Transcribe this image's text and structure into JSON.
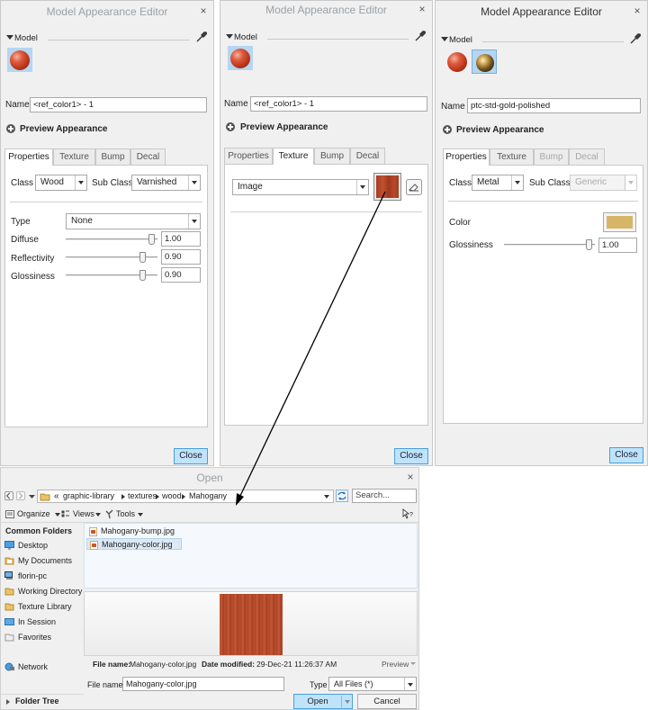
{
  "panel1": {
    "title": "Model Appearance Editor",
    "close_glyph": "×",
    "model_label": "Model",
    "name_label": "Name",
    "name_value": "<ref_color1> - 1",
    "preview_label": "Preview Appearance",
    "tabs": [
      "Properties",
      "Texture",
      "Bump",
      "Decal"
    ],
    "class_label": "Class",
    "class_value": "Wood",
    "subclass_label": "Sub Class",
    "subclass_value": "Varnished",
    "type_label": "Type",
    "type_value": "None",
    "diffuse_label": "Diffuse",
    "diffuse_value": "1.00",
    "reflectivity_label": "Reflectivity",
    "reflectivity_value": "0.90",
    "glossiness_label": "Glossiness",
    "glossiness_value": "0.90",
    "close_button": "Close"
  },
  "panel2": {
    "title": "Model Appearance Editor",
    "close_glyph": "×",
    "model_label": "Model",
    "name_label": "Name",
    "name_value": "<ref_color1> - 1",
    "preview_label": "Preview Appearance",
    "tabs": [
      "Properties",
      "Texture",
      "Bump",
      "Decal"
    ],
    "texture_type_value": "Image",
    "close_button": "Close"
  },
  "panel3": {
    "title": "Model Appearance Editor",
    "close_glyph": "×",
    "model_label": "Model",
    "name_label": "Name",
    "name_value": "ptc-std-gold-polished",
    "preview_label": "Preview Appearance",
    "tabs": [
      "Properties",
      "Texture",
      "Bump",
      "Decal"
    ],
    "class_label": "Class",
    "class_value": "Metal",
    "subclass_label": "Sub Class",
    "subclass_value": "Generic",
    "color_label": "Color",
    "glossiness_label": "Glossiness",
    "glossiness_value": "1.00",
    "close_button": "Close"
  },
  "open_dialog": {
    "title": "Open",
    "close_glyph": "×",
    "breadcrumb_prefix": "«",
    "breadcrumb": [
      "graphic-library",
      "textures",
      "wood",
      "Mahogany"
    ],
    "search_placeholder": "Search...",
    "toolbar": {
      "organize": "Organize",
      "views": "Views",
      "tools": "Tools"
    },
    "common_folders_label": "Common Folders",
    "sidebar": [
      "Desktop",
      "My Documents",
      "florin-pc",
      "Working Directory",
      "Texture Library",
      "In Session",
      "Favorites"
    ],
    "network_label": "Network",
    "folder_tree_label": "Folder Tree",
    "files": [
      "Mahogany-bump.jpg",
      "Mahogany-color.jpg"
    ],
    "info_filename_label": "File name:",
    "info_filename_value": "Mahogany-color.jpg",
    "info_modified_label": "Date modified:",
    "info_modified_value": "29-Dec-21 11:26:37 AM",
    "preview_label": "Preview",
    "filename_label": "File name",
    "filename_value": "Mahogany-color.jpg",
    "type_label": "Type",
    "type_value": "All Files (*)",
    "open_button": "Open",
    "cancel_button": "Cancel"
  },
  "colors": {
    "accent_button": "#bfe3fb",
    "gold_swatch": "#d6b567",
    "mahogany": "#b8472b"
  }
}
